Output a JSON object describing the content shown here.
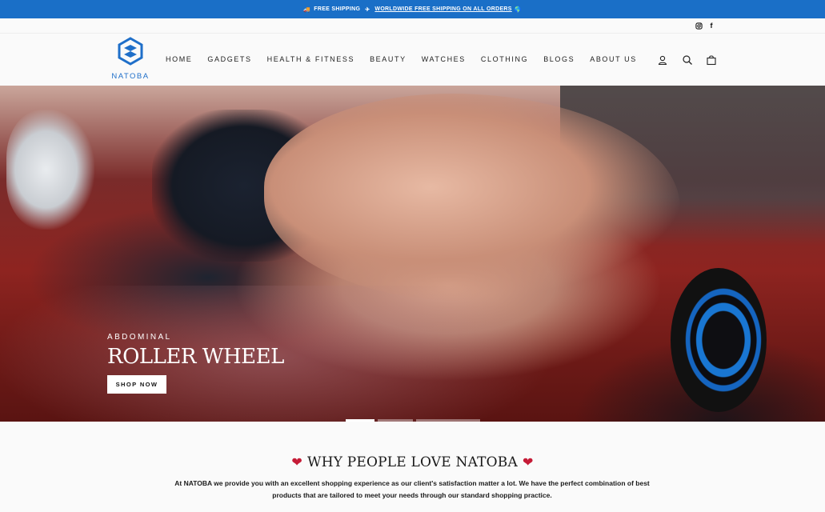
{
  "announcement": {
    "left_text": "FREE SHIPPING",
    "link_text": "WORLDWIDE FREE SHIPPING ON ALL ORDERS",
    "bg_color": "#1a6fc7"
  },
  "social": {
    "instagram": "instagram-icon",
    "facebook": "facebook-icon"
  },
  "header": {
    "logo_text": "NATOBA",
    "brand_color": "#1f6fc9",
    "nav": [
      "HOME",
      "GADGETS",
      "HEALTH & FITNESS",
      "BEAUTY",
      "WATCHES",
      "CLOTHING",
      "BLOGS",
      "ABOUT US"
    ],
    "icons": [
      "account-icon",
      "search-icon",
      "cart-icon"
    ]
  },
  "hero": {
    "subtitle": "ABDOMINAL",
    "title": "ROLLER WHEEL",
    "button": "SHOP NOW",
    "slides": 3,
    "active_slide": 1
  },
  "why": {
    "title": "WHY PEOPLE LOVE NATOBA",
    "heart_icon": "heart-icon",
    "text": "At NATOBA we provide you with an excellent shopping experience as our client's satisfaction matter a lot. We have the perfect combination of best products that are tailored to meet your needs through our standard shopping practice."
  }
}
